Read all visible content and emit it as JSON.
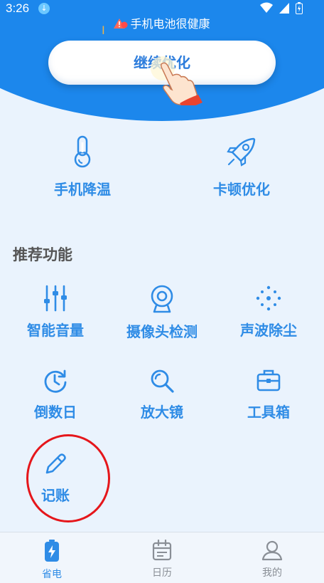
{
  "status_bar": {
    "time": "3:26"
  },
  "header": {
    "health_text": "手机电池很健康",
    "cta_label": "继续优化"
  },
  "quick_actions": [
    {
      "label": "手机降温",
      "icon": "thermometer-icon"
    },
    {
      "label": "卡顿优化",
      "icon": "rocket-icon"
    }
  ],
  "section": {
    "title": "推荐功能"
  },
  "features": [
    {
      "label": "智能音量",
      "icon": "sliders-icon"
    },
    {
      "label": "摄像头检测",
      "icon": "webcam-icon"
    },
    {
      "label": "声波除尘",
      "icon": "dust-dots-icon"
    },
    {
      "label": "倒数日",
      "icon": "countdown-clock-icon"
    },
    {
      "label": "放大镜",
      "icon": "magnifier-icon"
    },
    {
      "label": "工具箱",
      "icon": "toolbox-icon"
    },
    {
      "label": "记账",
      "icon": "pencil-icon"
    }
  ],
  "tabs": [
    {
      "label": "省电",
      "icon": "battery-charge-icon",
      "active": true
    },
    {
      "label": "日历",
      "icon": "calendar-icon",
      "active": false
    },
    {
      "label": "我的",
      "icon": "user-icon",
      "active": false
    }
  ],
  "colors": {
    "primary": "#1c87ec",
    "accent_text": "#2f8ce6",
    "annotation": "#e5161b"
  }
}
